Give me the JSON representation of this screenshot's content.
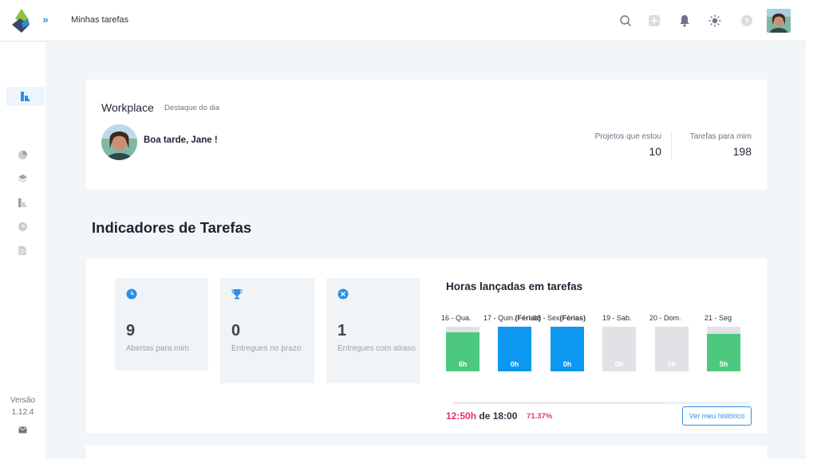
{
  "header": {
    "page_title": "Minhas tarefas",
    "icons": [
      "search-icon",
      "add-icon",
      "bell-icon",
      "sun-icon",
      "help-icon"
    ]
  },
  "sidebar": {
    "items": [
      "dashboard-icon",
      "pie-chart-icon",
      "layers-icon",
      "projects-icon",
      "clock-icon",
      "document-icon"
    ],
    "version_label": "Versão",
    "version_number": "1.12.4"
  },
  "workplace": {
    "title": "Workplace",
    "subtitle": "Destaque do dia",
    "greeting": "Boa tarde, Jane !",
    "stats": [
      {
        "label": "Projetos que estou",
        "value": "10"
      },
      {
        "label": "Tarefas para mim",
        "value": "198"
      }
    ]
  },
  "indicators": {
    "section_title": "Indicadores de Tarefas",
    "cards": [
      {
        "icon": "clock-icon",
        "value": "9",
        "label": "Abertas para mim"
      },
      {
        "icon": "trophy-icon",
        "value": "0",
        "label": "Entregues no prazo"
      },
      {
        "icon": "x-circle-icon",
        "value": "1",
        "label": "Entregues com atraso"
      }
    ]
  },
  "hours": {
    "title": "Horas lançadas em tarefas",
    "worked": "12:50h",
    "of_label": "de 18:00",
    "percent": "71.37%",
    "progress_fraction": 0.7137,
    "button_label": "Ver meu histórico",
    "colors": {
      "green": "#4cc97e",
      "blue": "#0c97f0",
      "grey": "#e0e2e5",
      "accent": "#e2336b"
    },
    "days": [
      {
        "label": "16 - Qua.",
        "tag": "",
        "value": "6h",
        "fill": 0.88,
        "color": "green"
      },
      {
        "label": "17 - Quin.",
        "tag": "(Férias)",
        "value": "0h",
        "fill": 1.0,
        "color": "blue"
      },
      {
        "label": "18 - Sex",
        "tag": "(Férias)",
        "value": "0h",
        "fill": 1.0,
        "color": "blue"
      },
      {
        "label": "19 - Sab.",
        "tag": "",
        "value": "0h",
        "fill": 1.0,
        "color": "grey"
      },
      {
        "label": "20 - Dom.",
        "tag": "",
        "value": "0h",
        "fill": 1.0,
        "color": "grey"
      },
      {
        "label": "21 - Seg",
        "tag": "",
        "value": "5h",
        "fill": 0.84,
        "color": "green"
      }
    ]
  }
}
